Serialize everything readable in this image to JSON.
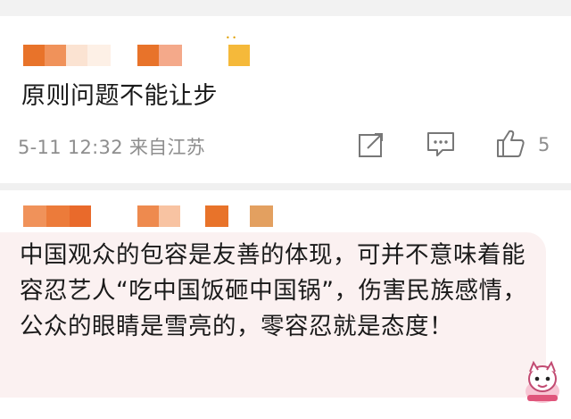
{
  "comments": [
    {
      "text": "原则问题不能让步",
      "timestamp": "5-11 12:32",
      "location": "来自江苏",
      "like_count": "5",
      "icons": [
        "share-icon",
        "comment-icon",
        "like-icon"
      ]
    },
    {
      "text": "中国观众的包容是友善的体现，可并不意味着能容忍艺人“吃中国饭砸中国锅”，伤害民族感情，公众的眼睛是雪亮的，零容忍就是态度！",
      "sticker": "pink-character-sticker-icon"
    }
  ],
  "colors": {
    "bubble_bg": "#fbf1f1",
    "meta_text": "#8e8e8e",
    "body_text": "#1a1a1a",
    "censor_orange": "#e8732a",
    "censor_yellow": "#f5b93a"
  }
}
